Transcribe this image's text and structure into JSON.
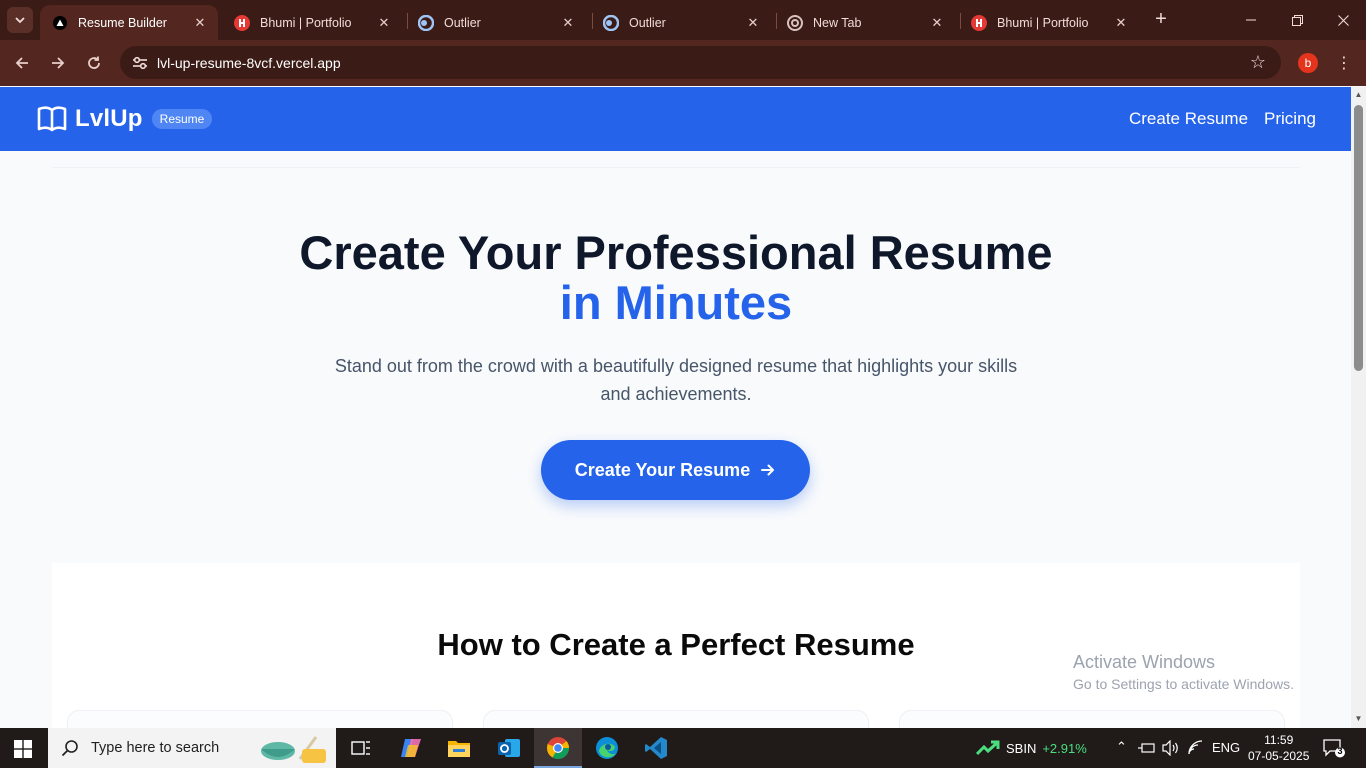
{
  "browser": {
    "tabs": [
      {
        "title": "Resume Builder",
        "favicon": "vercel-triangle-icon",
        "active": true
      },
      {
        "title": "Bhumi | Portfolio",
        "favicon": "portfolio-icon",
        "active": false
      },
      {
        "title": "Outlier",
        "favicon": "outlier-icon",
        "active": false
      },
      {
        "title": "Outlier",
        "favicon": "outlier-icon",
        "active": false
      },
      {
        "title": "New Tab",
        "favicon": "chrome-icon",
        "active": false
      },
      {
        "title": "Bhumi | Portfolio",
        "favicon": "portfolio-icon",
        "active": false
      }
    ],
    "url": "lvl-up-resume-8vcf.vercel.app",
    "profile_initial": "b"
  },
  "site": {
    "logo_text": "LvlUp",
    "logo_badge": "Resume",
    "nav": [
      "Create Resume",
      "Pricing"
    ]
  },
  "hero": {
    "title_line1": "Create Your Professional Resume",
    "title_line2": "in Minutes",
    "subtitle": "Stand out from the crowd with a beautifully designed resume that highlights your skills and achievements.",
    "cta_label": "Create Your Resume"
  },
  "steps": {
    "title": "How to Create a Perfect Resume"
  },
  "watermark": {
    "line1": "Activate Windows",
    "line2": "Go to Settings to activate Windows."
  },
  "taskbar": {
    "search_placeholder": "Type here to search",
    "stock_symbol": "SBIN",
    "stock_change": "+2.91%",
    "language": "ENG",
    "time": "11:59",
    "date": "07-05-2025",
    "notification_count": "3"
  },
  "colors": {
    "brand": "#2563eb",
    "chrome_dark": "#3b1b16",
    "chrome_toolbar": "#542620"
  }
}
